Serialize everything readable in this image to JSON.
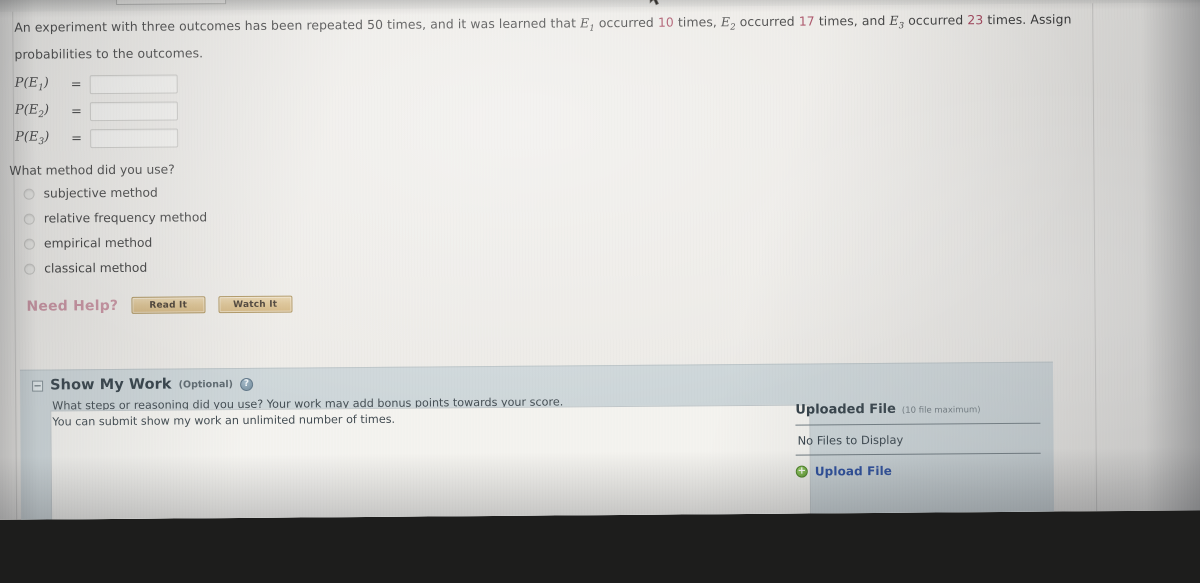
{
  "browser": {
    "tabs": [
      "",
      "",
      "",
      "",
      ""
    ]
  },
  "question": {
    "line1_a": "An experiment with three outcomes has been repeated",
    "trials": "50",
    "line1_b": "times, and it was learned that",
    "e1": "E",
    "e1_sub": "1",
    "occurred": "occurred",
    "count1": "10",
    "times_comma": "times,",
    "e2": "E",
    "e2_sub": "2",
    "count2": "17",
    "times_and": "times, and",
    "e3": "E",
    "e3_sub": "3",
    "count3": "23",
    "tail": "times. Assign probabilities",
    "line2": "to the outcomes."
  },
  "probability_inputs": [
    {
      "label_p": "P(",
      "label_e": "E",
      "label_sub": "1",
      "label_close": ")",
      "eq": "=",
      "value": "",
      "placeholder": ""
    },
    {
      "label_p": "P(",
      "label_e": "E",
      "label_sub": "2",
      "label_close": ")",
      "eq": "=",
      "value": "",
      "placeholder": ""
    },
    {
      "label_p": "P(",
      "label_e": "E",
      "label_sub": "3",
      "label_close": ")",
      "eq": "=",
      "value": "",
      "placeholder": ""
    }
  ],
  "method": {
    "prompt": "What method did you use?",
    "selected": null,
    "options": [
      {
        "label": "subjective method"
      },
      {
        "label": "relative frequency method"
      },
      {
        "label": "empirical method"
      },
      {
        "label": "classical method"
      }
    ]
  },
  "need_help": {
    "label": "Need Help?",
    "label_color": "#c58c9b",
    "buttons": [
      {
        "label": "Read It"
      },
      {
        "label": "Watch It"
      }
    ]
  },
  "show_my_work": {
    "collapse_glyph": "−",
    "title": "Show My Work",
    "optional": "(Optional)",
    "help_icon_glyph": "?",
    "description_line1": "What steps or reasoning did you use? Your work may add bonus points towards your score.",
    "description_line2": "You can submit show my work an unlimited number of times.",
    "editor_value": "",
    "panel_color": "#ccd5d8"
  },
  "uploaded_file": {
    "title": "Uploaded File",
    "max_note": "(10 file maximum)",
    "empty_state": "No Files to Display",
    "upload_link": "Upload File",
    "upload_link_color": "#2b4fa0",
    "plus_icon_glyph": "+"
  }
}
